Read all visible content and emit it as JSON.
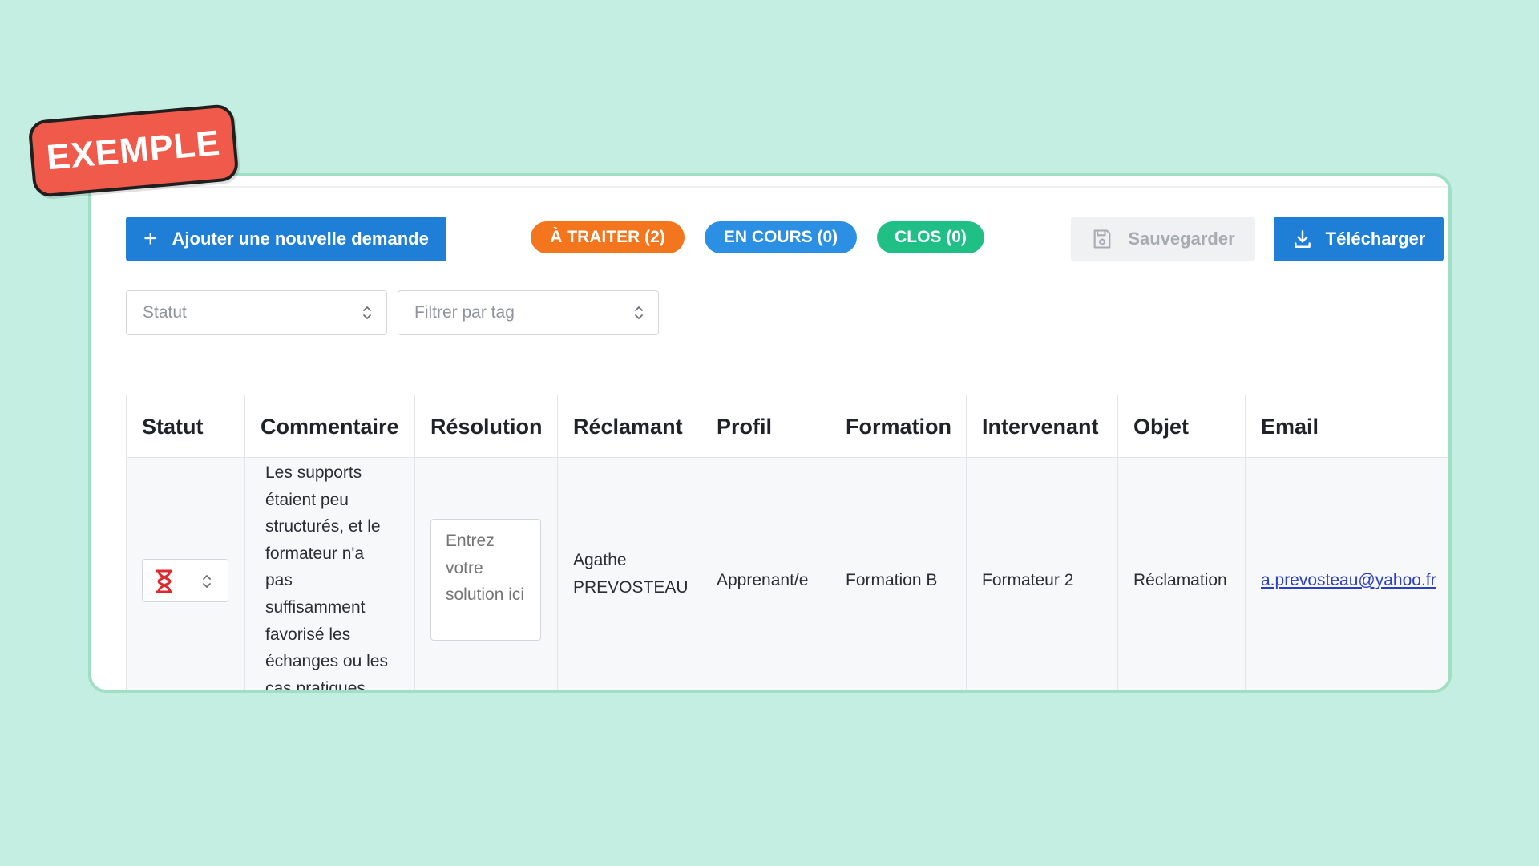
{
  "example_tag": "EXEMPLE",
  "toolbar": {
    "add_label": "Ajouter une nouvelle demande",
    "pills": {
      "traiter": "À TRAITER (2)",
      "encours": "EN COURS (0)",
      "clos": "CLOS (0)"
    },
    "save_label": "Sauvegarder",
    "download_label": "Télécharger"
  },
  "filters": {
    "statut_placeholder": "Statut",
    "tag_placeholder": "Filtrer par tag"
  },
  "table": {
    "headers": [
      "Statut",
      "Commentaire",
      "Résolution",
      "Réclamant",
      "Profil",
      "Formation",
      "Intervenant",
      "Objet",
      "Email"
    ],
    "row": {
      "comment_lines": [
        "Les supports",
        "étaient peu",
        "structurés, et le",
        "formateur n'a",
        "pas",
        "suffisamment",
        "favorisé les",
        "échanges ou les",
        "cas pratiques"
      ],
      "resolution_placeholder": "Entrez votre solution ici",
      "claimant_lines": [
        "Agathe",
        "PREVOSTEAU"
      ],
      "profile": "Apprenant/e",
      "formation": "Formation B",
      "intervenant": "Formateur 2",
      "objet": "Réclamation",
      "email": "a.prevosteau@yahoo.fr"
    }
  },
  "colors": {
    "primary": "#1f7fd6",
    "traiter": "#f3751d",
    "encours": "#2b8fe3",
    "clos": "#1fbf86",
    "status_icon": "#e0282f",
    "tag": "#ef5a4a",
    "background": "#c4eee2"
  },
  "icons": {
    "add": "plus-icon",
    "save": "floppy-disk-icon",
    "download": "download-icon",
    "status": "hourglass-icon",
    "select": "chevron-up-down-icon"
  }
}
